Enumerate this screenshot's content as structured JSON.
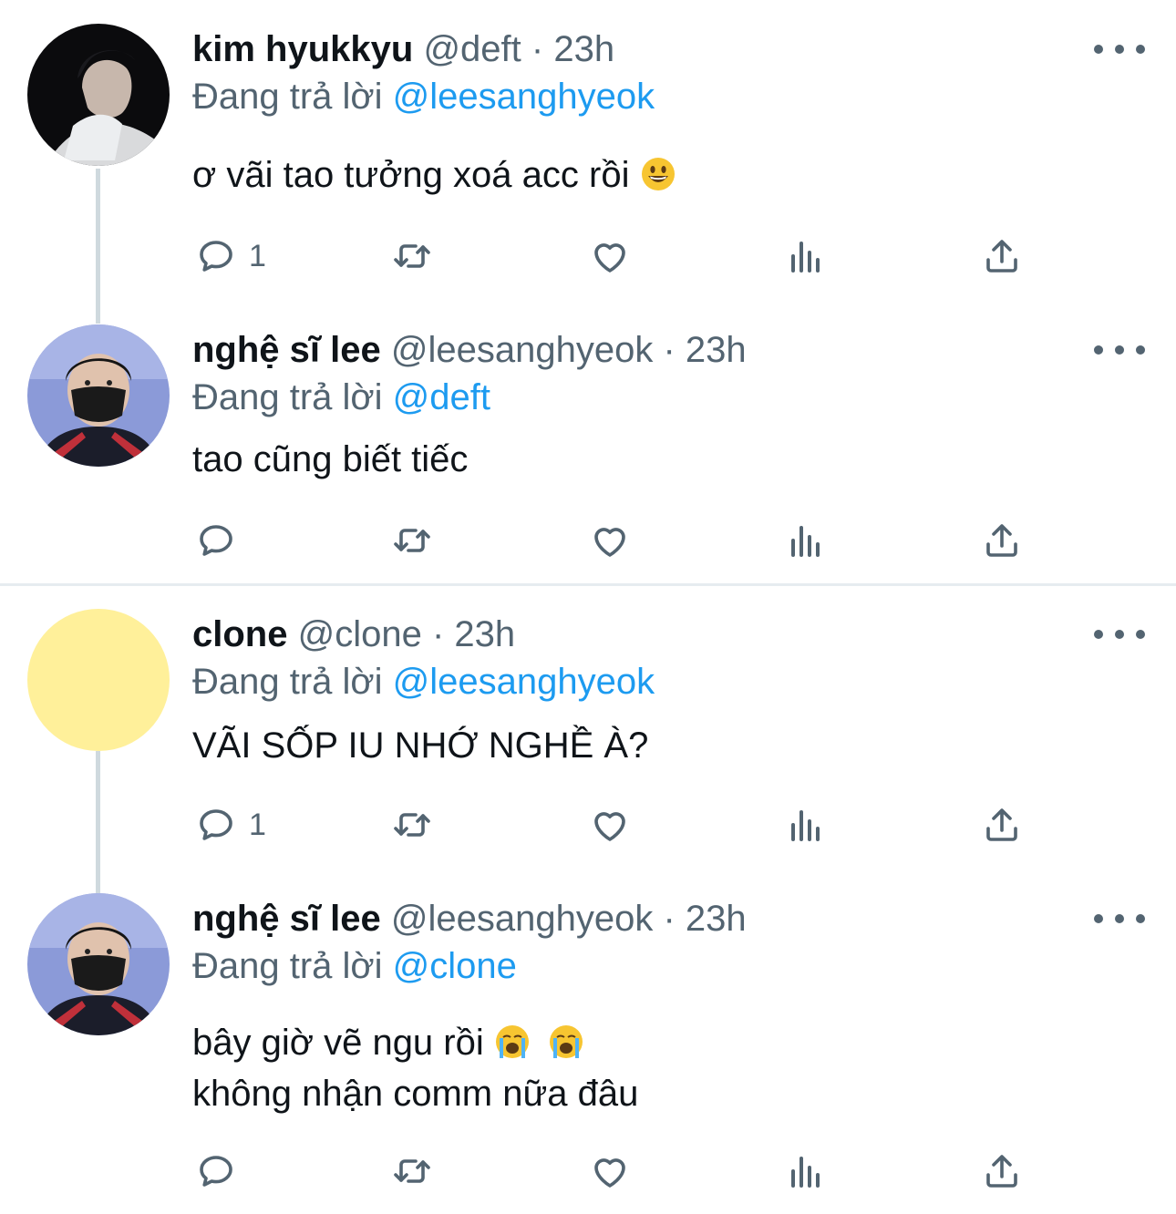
{
  "tweets": [
    {
      "name": "kim hyukkyu",
      "handle": "@deft",
      "sep": "·",
      "time": "23h",
      "replying_prefix": "Đang trả lời",
      "replying_to": "@leesanghyeok",
      "lines": [
        "ơ vãi tao tưởng xoá acc rồi"
      ],
      "emoji": "grinning-face",
      "reply_count": "1",
      "avatar": "dark-photo"
    },
    {
      "name": "nghệ sĩ lee",
      "handle": "@leesanghyeok",
      "sep": "·",
      "time": "23h",
      "replying_prefix": "Đang trả lời",
      "replying_to": "@deft",
      "lines": [
        "tao cũng biết tiếc"
      ],
      "reply_count": "",
      "avatar": "masked-player"
    },
    {
      "name": "clone",
      "handle": "@clone",
      "sep": "·",
      "time": "23h",
      "replying_prefix": "Đang trả lời",
      "replying_to": "@leesanghyeok",
      "lines": [
        "VÃI SỐP IU NHỚ NGHỀ À?"
      ],
      "reply_count": "1",
      "avatar": "yellow-circle"
    },
    {
      "name": "nghệ sĩ lee",
      "handle": "@leesanghyeok",
      "sep": "·",
      "time": "23h",
      "replying_prefix": "Đang trả lời",
      "replying_to": "@clone",
      "lines": [
        "bây giờ vẽ ngu rồi",
        "không nhận comm nữa đâu"
      ],
      "emoji": "loudly-crying-face",
      "reply_count": "",
      "avatar": "masked-player"
    }
  ],
  "colors": {
    "link": "#1d9bf0",
    "muted": "#536471",
    "text": "#0f1419",
    "thread_line": "#cfd9de",
    "yellow_avatar": "#fff09a"
  },
  "icons": [
    "reply-icon",
    "retweet-icon",
    "like-icon",
    "views-icon",
    "share-icon",
    "more-icon"
  ]
}
